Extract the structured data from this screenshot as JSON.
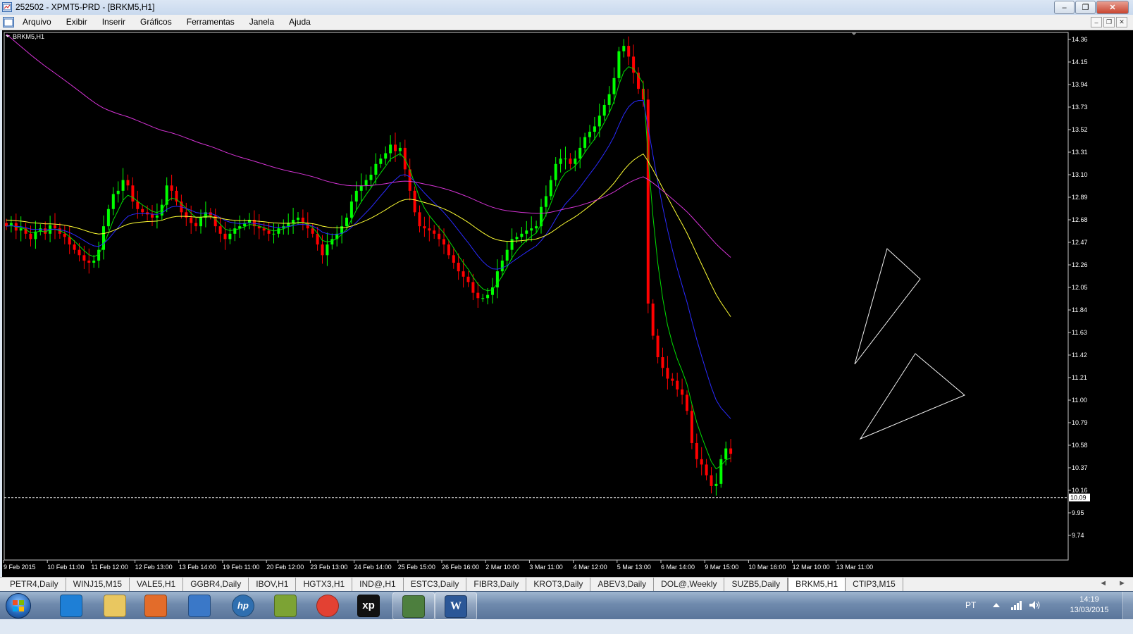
{
  "window": {
    "title": "252502 - XPMT5-PRD - [BRKM5,H1]"
  },
  "menu": {
    "items": [
      "Arquivo",
      "Exibir",
      "Inserir",
      "Gráficos",
      "Ferramentas",
      "Janela",
      "Ajuda"
    ]
  },
  "chart": {
    "label": "BRKM5,H1",
    "current_price": "10.09",
    "colors": {
      "bull": "#00ff00",
      "bear": "#ff0000",
      "ma_fast": "#00dd00",
      "ma_mid": "#2a2aff",
      "ma_slow": "#ffff33",
      "ma_long": "#d633d6"
    }
  },
  "chart_data": {
    "type": "candlestick",
    "title": "BRKM5,H1",
    "y_ticks": [
      "14.36",
      "14.15",
      "13.94",
      "13.73",
      "13.52",
      "13.31",
      "13.10",
      "12.89",
      "12.68",
      "12.47",
      "12.26",
      "12.05",
      "11.84",
      "11.63",
      "11.42",
      "11.21",
      "11.00",
      "10.79",
      "10.58",
      "10.37",
      "10.16",
      "9.95",
      "9.74"
    ],
    "x_ticks": [
      "9 Feb 2015",
      "10 Feb 11:00",
      "11 Feb 12:00",
      "12 Feb 13:00",
      "13 Feb 14:00",
      "19 Feb 11:00",
      "20 Feb 12:00",
      "23 Feb 13:00",
      "24 Feb 14:00",
      "25 Feb 15:00",
      "26 Feb 16:00",
      "2 Mar 10:00",
      "3 Mar 11:00",
      "4 Mar 12:00",
      "5 Mar 13:00",
      "6 Mar 14:00",
      "9 Mar 15:00",
      "10 Mar 16:00",
      "12 Mar 10:00",
      "13 Mar 11:00"
    ],
    "ylim": [
      9.6,
      14.41
    ],
    "horizontal_line": 10.09,
    "close_series": [
      12.62,
      12.65,
      12.58,
      12.6,
      12.55,
      12.5,
      12.57,
      12.6,
      12.55,
      12.63,
      12.6,
      12.55,
      12.52,
      12.45,
      12.4,
      12.35,
      12.3,
      12.28,
      12.3,
      12.4,
      12.62,
      12.78,
      12.92,
      12.95,
      13.05,
      13.0,
      12.85,
      12.78,
      12.75,
      12.73,
      12.7,
      12.72,
      12.82,
      13.0,
      12.95,
      12.85,
      12.75,
      12.7,
      12.65,
      12.62,
      12.7,
      12.75,
      12.72,
      12.62,
      12.55,
      12.5,
      12.55,
      12.6,
      12.62,
      12.65,
      12.68,
      12.62,
      12.6,
      12.58,
      12.55,
      12.55,
      12.6,
      12.62,
      12.65,
      12.68,
      12.7,
      12.65,
      12.6,
      12.55,
      12.45,
      12.35,
      12.45,
      12.5,
      12.55,
      12.62,
      12.7,
      12.85,
      12.95,
      13.0,
      13.05,
      13.1,
      13.2,
      13.25,
      13.3,
      13.38,
      13.32,
      13.35,
      13.15,
      12.95,
      12.75,
      12.62,
      12.6,
      12.58,
      12.55,
      12.5,
      12.45,
      12.35,
      12.28,
      12.2,
      12.15,
      12.1,
      12.0,
      11.95,
      11.95,
      11.98,
      12.05,
      12.2,
      12.3,
      12.4,
      12.5,
      12.52,
      12.55,
      12.58,
      12.6,
      12.62,
      12.8,
      12.9,
      13.05,
      13.2,
      13.25,
      13.25,
      13.2,
      13.25,
      13.35,
      13.45,
      13.5,
      13.55,
      13.65,
      13.75,
      13.85,
      14.0,
      14.25,
      14.3,
      14.2,
      14.05,
      13.9,
      13.8,
      11.9,
      11.6,
      11.4,
      11.3,
      11.2,
      11.18,
      11.1,
      11.05,
      10.9,
      10.6,
      10.45,
      10.4,
      10.3,
      10.2,
      10.22,
      10.45,
      10.55,
      10.5
    ],
    "moving_averages": [
      {
        "color": "green",
        "period": "fast"
      },
      {
        "color": "blue",
        "period": "medium"
      },
      {
        "color": "yellow",
        "period": "slow"
      },
      {
        "color": "magenta",
        "period": "long"
      }
    ]
  },
  "tabs": [
    "PETR4,Daily",
    "WINJ15,M15",
    "VALE5,H1",
    "GGBR4,Daily",
    "IBOV,H1",
    "HGTX3,H1",
    "IND@,H1",
    "ESTC3,Daily",
    "FIBR3,Daily",
    "KROT3,Daily",
    "ABEV3,Daily",
    "DOL@,Weekly",
    "SUZB5,Daily",
    "BRKM5,H1",
    "CTIP3,M15"
  ],
  "active_tab": "BRKM5,H1",
  "taskbar": {
    "apps": [
      "internet-explorer-icon",
      "file-explorer-icon",
      "media-player-icon",
      "network-icon",
      "hp-icon",
      "ftp-icon",
      "chrome-icon",
      "xp-icon",
      "metatrader-icon",
      "word-icon"
    ],
    "language": "PT",
    "time": "14:19",
    "date": "13/03/2015"
  }
}
